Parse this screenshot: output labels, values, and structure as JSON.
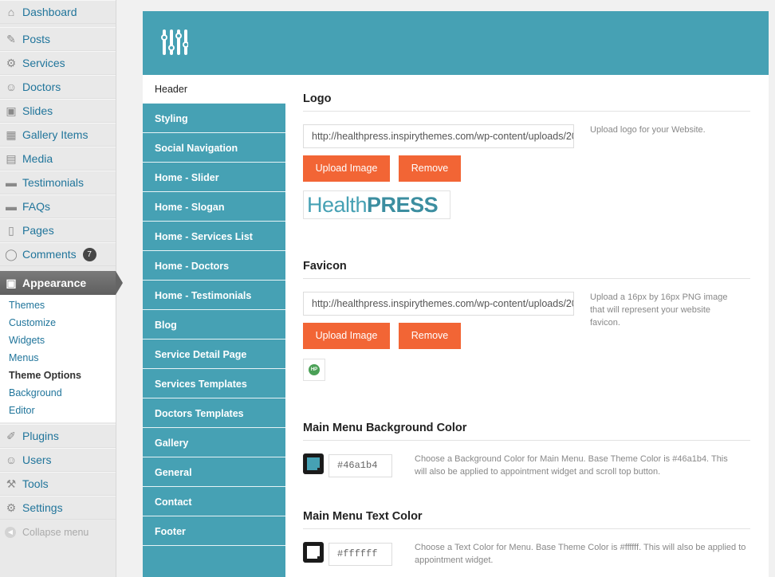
{
  "menu": {
    "items": [
      {
        "label": "Dashboard",
        "icon": "dashboard-icon",
        "glyph": "⌂"
      },
      {
        "label": "Posts",
        "icon": "pin-icon",
        "glyph": "✎"
      },
      {
        "label": "Services",
        "icon": "gear-icon",
        "glyph": "⚙"
      },
      {
        "label": "Doctors",
        "icon": "users-icon",
        "glyph": "☺"
      },
      {
        "label": "Slides",
        "icon": "image-icon",
        "glyph": "▣"
      },
      {
        "label": "Gallery Items",
        "icon": "grid-icon",
        "glyph": "▦"
      },
      {
        "label": "Media",
        "icon": "media-icon",
        "glyph": "▤"
      },
      {
        "label": "Testimonials",
        "icon": "comment-icon",
        "glyph": "▬"
      },
      {
        "label": "FAQs",
        "icon": "comment-icon",
        "glyph": "▬"
      },
      {
        "label": "Pages",
        "icon": "pages-icon",
        "glyph": "▯"
      },
      {
        "label": "Comments",
        "icon": "speech-bubble-icon",
        "glyph": "◯",
        "badge": "7"
      }
    ],
    "active": {
      "label": "Appearance",
      "icon": "appearance-icon",
      "glyph": "▣"
    },
    "submenu": [
      "Themes",
      "Customize",
      "Widgets",
      "Menus",
      "Theme Options",
      "Background",
      "Editor"
    ],
    "bottom_items": [
      {
        "label": "Plugins",
        "icon": "plug-icon",
        "glyph": "✐"
      },
      {
        "label": "Users",
        "icon": "users-icon",
        "glyph": "☺"
      },
      {
        "label": "Tools",
        "icon": "wrench-icon",
        "glyph": "⚒"
      },
      {
        "label": "Settings",
        "icon": "settings-icon",
        "glyph": "⚙"
      }
    ],
    "collapse_label": "Collapse menu"
  },
  "panel": {
    "header_icon": "sliders-icon",
    "accent_color": "#46a1b4",
    "tabs": [
      "Header",
      "Styling",
      "Social Navigation",
      "Home - Slider",
      "Home - Slogan",
      "Home - Services List",
      "Home - Doctors",
      "Home - Testimonials",
      "Blog",
      "Service Detail Page",
      "Services Templates",
      "Doctors Templates",
      "Gallery",
      "General",
      "Contact",
      "Footer"
    ],
    "active_tab": "Header"
  },
  "logo": {
    "title": "Logo",
    "url": "http://healthpress.inspirythemes.com/wp-content/uploads/2014/logo.png",
    "upload_label": "Upload Image",
    "remove_label": "Remove",
    "help": "Upload logo for your Website.",
    "preview_light": "Health",
    "preview_bold": "PRESS"
  },
  "favicon": {
    "title": "Favicon",
    "url": "http://healthpress.inspirythemes.com/wp-content/uploads/2014/favicon.png",
    "upload_label": "Upload Image",
    "remove_label": "Remove",
    "help": "Upload a 16px by 16px PNG image that will represent your website favicon.",
    "preview_text": "HP"
  },
  "menu_bg": {
    "title": "Main Menu Background Color",
    "value": "#46a1b4",
    "help": "Choose a Background Color for Main Menu. Base Theme Color is #46a1b4. This will also be applied to appointment widget and scroll top button."
  },
  "menu_text": {
    "title": "Main Menu Text Color",
    "value": "#ffffff",
    "help": "Choose a Text Color for Menu. Base Theme Color is #ffffff. This will also be applied to appointment widget."
  },
  "button_color": "#f26535"
}
